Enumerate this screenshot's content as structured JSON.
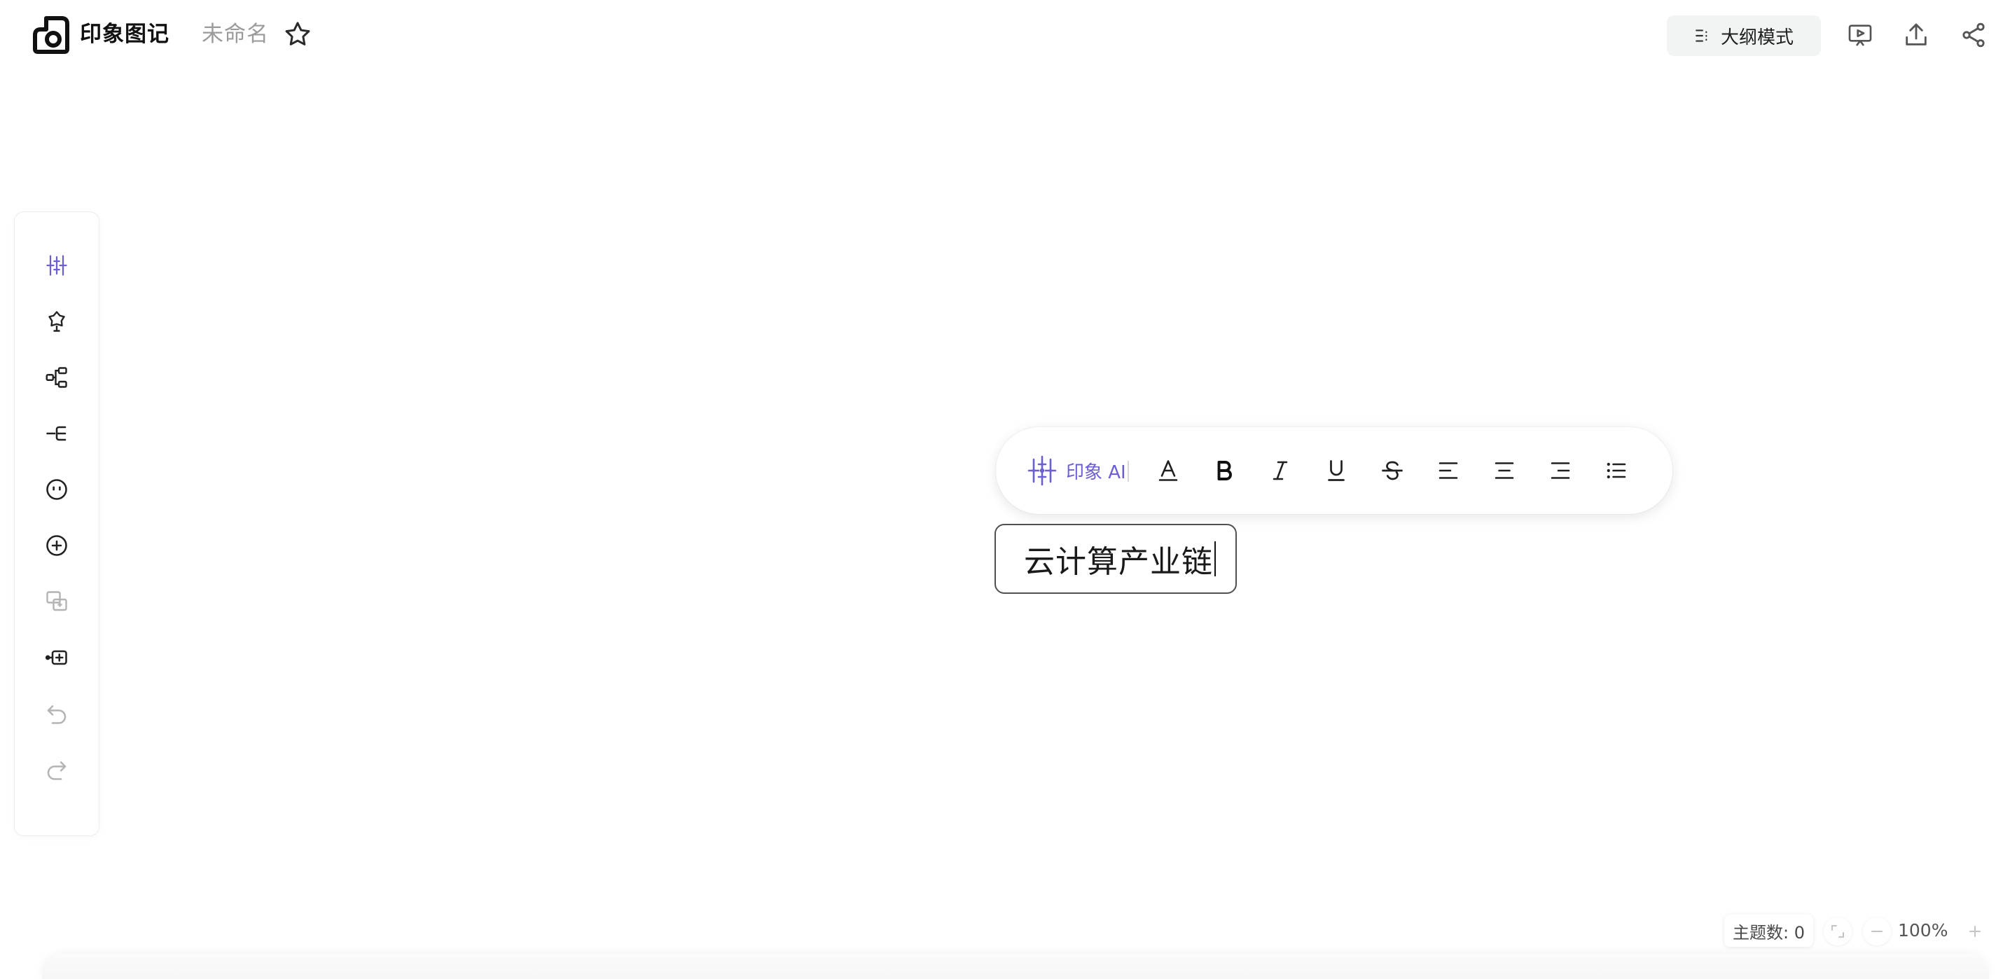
{
  "header": {
    "app_name": "印象图记",
    "doc_title": "未命名",
    "outline_mode_label": "大纲模式",
    "icons": [
      "logo-icon",
      "star-icon",
      "outline-icon",
      "present-icon",
      "export-icon",
      "share-icon"
    ]
  },
  "left_toolbar": {
    "tools": [
      "ai-sparkle-icon",
      "theme-icon",
      "structure-icon",
      "insert-child-icon",
      "emoji-icon",
      "add-topic-icon",
      "copy-style-icon",
      "insert-sibling-icon",
      "undo-icon",
      "redo-icon"
    ]
  },
  "format_toolbar": {
    "ai_label": "印象 AI",
    "buttons": [
      "text-color-icon",
      "bold-icon",
      "italic-icon",
      "underline-icon",
      "strikethrough-icon",
      "align-left-icon",
      "align-center-icon",
      "align-right-icon",
      "bullet-list-icon"
    ]
  },
  "canvas": {
    "topic_text": "云计算产业链"
  },
  "footer": {
    "topic_count_label": "主题数: 0",
    "zoom_level": "100%"
  },
  "colors": {
    "accent_purple": "#6b5fd3",
    "outline_button_bg": "#f1f4f3",
    "node_border": "#505050",
    "muted_text": "#9b9b9b"
  }
}
